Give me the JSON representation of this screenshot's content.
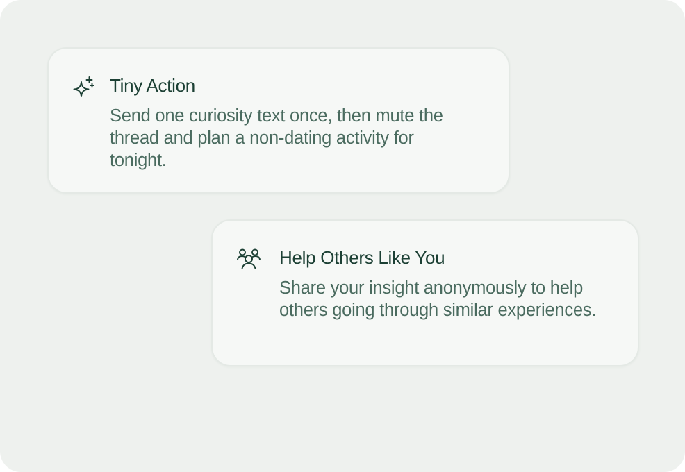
{
  "cards": [
    {
      "icon": "sparkle-icon",
      "title": "Tiny Action",
      "body": "Send one curiosity text once, then mute the thread and plan a non-dating activity for tonight."
    },
    {
      "icon": "users-icon",
      "title": "Help Others Like You",
      "body": "Share your insight anonymously to help others going through similar experiences."
    }
  ],
  "colors": {
    "background": "#eef1ee",
    "card": "#f6f8f6",
    "title": "#1c4034",
    "body": "#4a6b5f",
    "icon": "#1c4034"
  }
}
